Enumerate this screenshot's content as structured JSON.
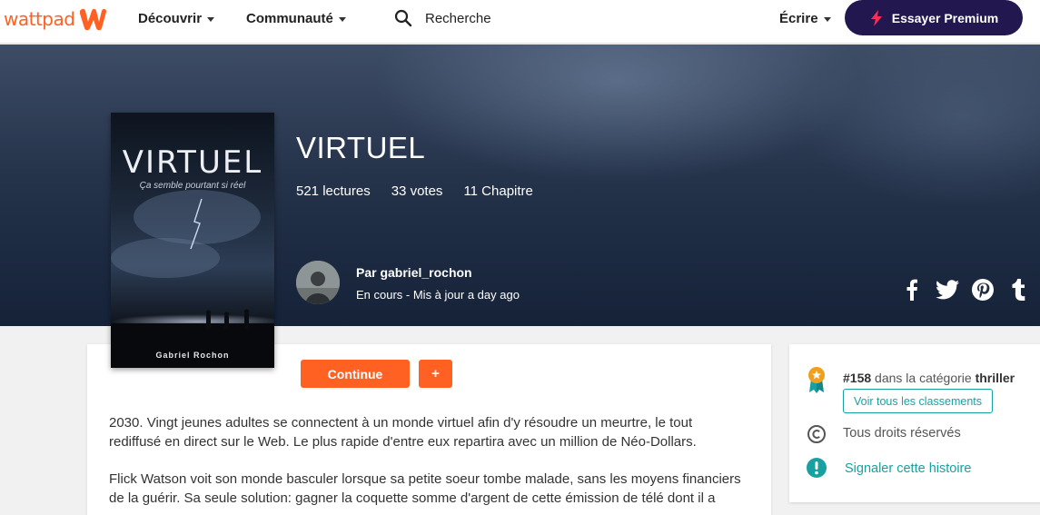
{
  "nav": {
    "logo_text": "wattpad",
    "discover_label": "Découvrir",
    "community_label": "Communauté",
    "search_placeholder": "Recherche",
    "write_label": "Écrire",
    "premium_label": "Essayer Premium"
  },
  "story": {
    "title": "VIRTUEL",
    "reads": "521 lectures",
    "votes": "33 votes",
    "chapters": "11 Chapitre",
    "author": "Par gabriel_rochon",
    "status": "En cours - Mis à jour a day ago"
  },
  "cover": {
    "title": "VIRTUEL",
    "subtitle": "Ça semble pourtant si réel",
    "author": "Gabriel Rochon"
  },
  "actions": {
    "continue_label": "Continue",
    "add_label": "+"
  },
  "description": {
    "paragraph1_line1": "2030. Vingt jeunes adultes se connectent à un monde virtuel afin d'y résoudre un meurtre, le tout",
    "paragraph1_line2": "rediffusé en direct sur le Web. Le plus rapide d'entre eux repartira avec un million de Néo-Dollars.",
    "paragraph2_line1": "Flick Watson voit son monde basculer lorsque sa petite soeur tombe malade, sans les moyens financiers",
    "paragraph2_line2": "de la guérir. Sa seule solution: gagner la coquette somme d'argent de cette émission de télé dont il a"
  },
  "sidebar": {
    "rank_number": "#158",
    "rank_mid": " dans la catégorie ",
    "rank_category": "thriller",
    "rankings_button": "Voir tous les classements",
    "rights": "Tous droits réservés",
    "report": "Signaler cette histoire"
  },
  "colors": {
    "brand": "#ff6122",
    "premium": "#22174e",
    "teal": "#19a1a1"
  },
  "icons": [
    "wattpad-w-logo",
    "search-icon",
    "lightning-icon",
    "facebook-icon",
    "twitter-icon",
    "pinterest-icon",
    "tumblr-icon",
    "ribbon-icon",
    "copyright-icon",
    "alert-icon"
  ]
}
